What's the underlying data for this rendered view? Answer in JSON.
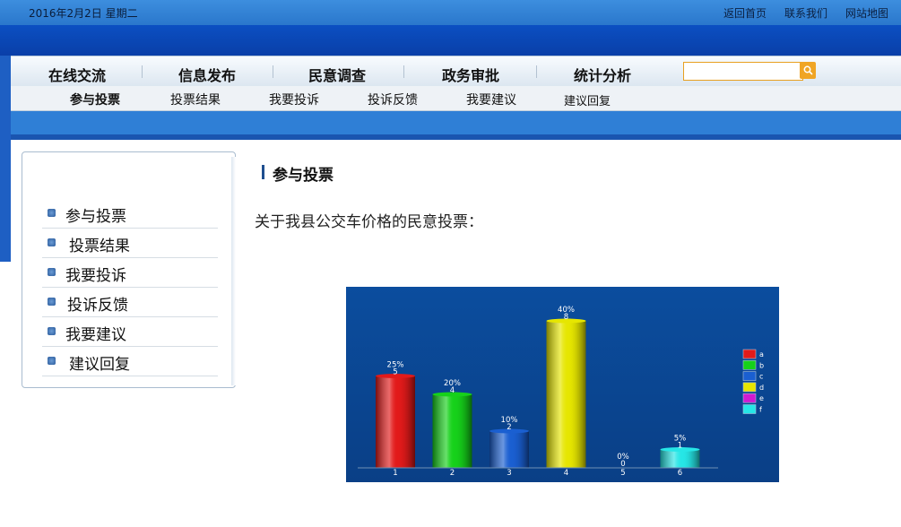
{
  "topbar": {
    "date": "2016年2月2日  星期二",
    "links": [
      "返回首页",
      "联系我们",
      "网站地图"
    ]
  },
  "nav": {
    "items": [
      "在线交流",
      "信息发布",
      "民意调查",
      "政务审批",
      "统计分析"
    ],
    "search_placeholder": ""
  },
  "subnav": {
    "items": [
      "参与投票",
      "投票结果",
      "我要投诉",
      "投诉反馈",
      "我要建议",
      "建议回复"
    ]
  },
  "sidebar": {
    "items": [
      "参与投票",
      "投票结果",
      "我要投诉",
      "投诉反馈",
      "我要建议",
      "建议回复"
    ]
  },
  "content": {
    "title": "参与投票",
    "question": "关于我县公交车价格的民意投票："
  },
  "icons": {
    "search": "search-icon",
    "bullet": "bullet-icon"
  },
  "colors": {
    "accent": "#2a77cc",
    "banner": "#0b4fc2",
    "chart_bg": "#0b4d9e"
  },
  "chart_data": {
    "type": "bar",
    "categories": [
      "1",
      "2",
      "3",
      "4",
      "5",
      "6"
    ],
    "values": [
      5,
      4,
      2,
      8,
      0,
      1
    ],
    "percent_labels": [
      "25%",
      "20%",
      "10%",
      "40%",
      "0%",
      "5%"
    ],
    "colors": [
      "#e21a1a",
      "#16d11a",
      "#1a5fd1",
      "#e6e600",
      "#d11ad1",
      "#26e6e6"
    ],
    "legend": [
      "a",
      "b",
      "c",
      "d",
      "e",
      "f"
    ],
    "legend_position": "right",
    "ylim": [
      0,
      8
    ],
    "title": "",
    "xlabel": "",
    "ylabel": ""
  }
}
